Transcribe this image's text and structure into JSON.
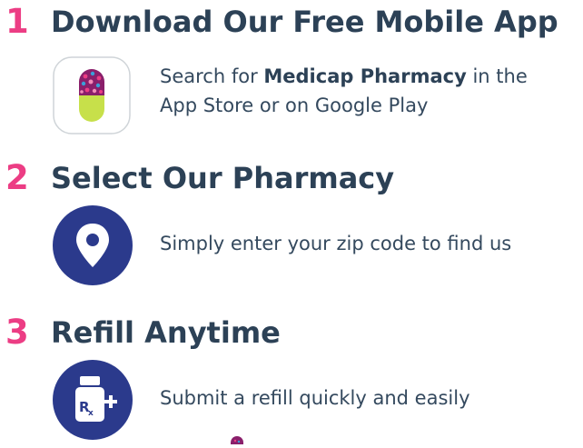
{
  "steps": [
    {
      "number": "1",
      "title": "Download Our Free Mobile App",
      "text_before": "Search for ",
      "text_bold": "Medicap Pharmacy",
      "text_after": " in the",
      "text_line2": "App Store or on Google Play",
      "icon": "pill-app-icon"
    },
    {
      "number": "2",
      "title": "Select Our Pharmacy",
      "text": "Simply enter your zip code to find us",
      "icon": "map-pin-icon"
    },
    {
      "number": "3",
      "title": "Refill Anytime",
      "text": "Submit a refill quickly and easily",
      "icon": "rx-bottle-icon"
    }
  ],
  "colors": {
    "number": "#ec3d84",
    "title": "#2c4156",
    "circle": "#2b3a8c",
    "pill_top": "#8a1f6b",
    "pill_bottom": "#c7e04a"
  }
}
